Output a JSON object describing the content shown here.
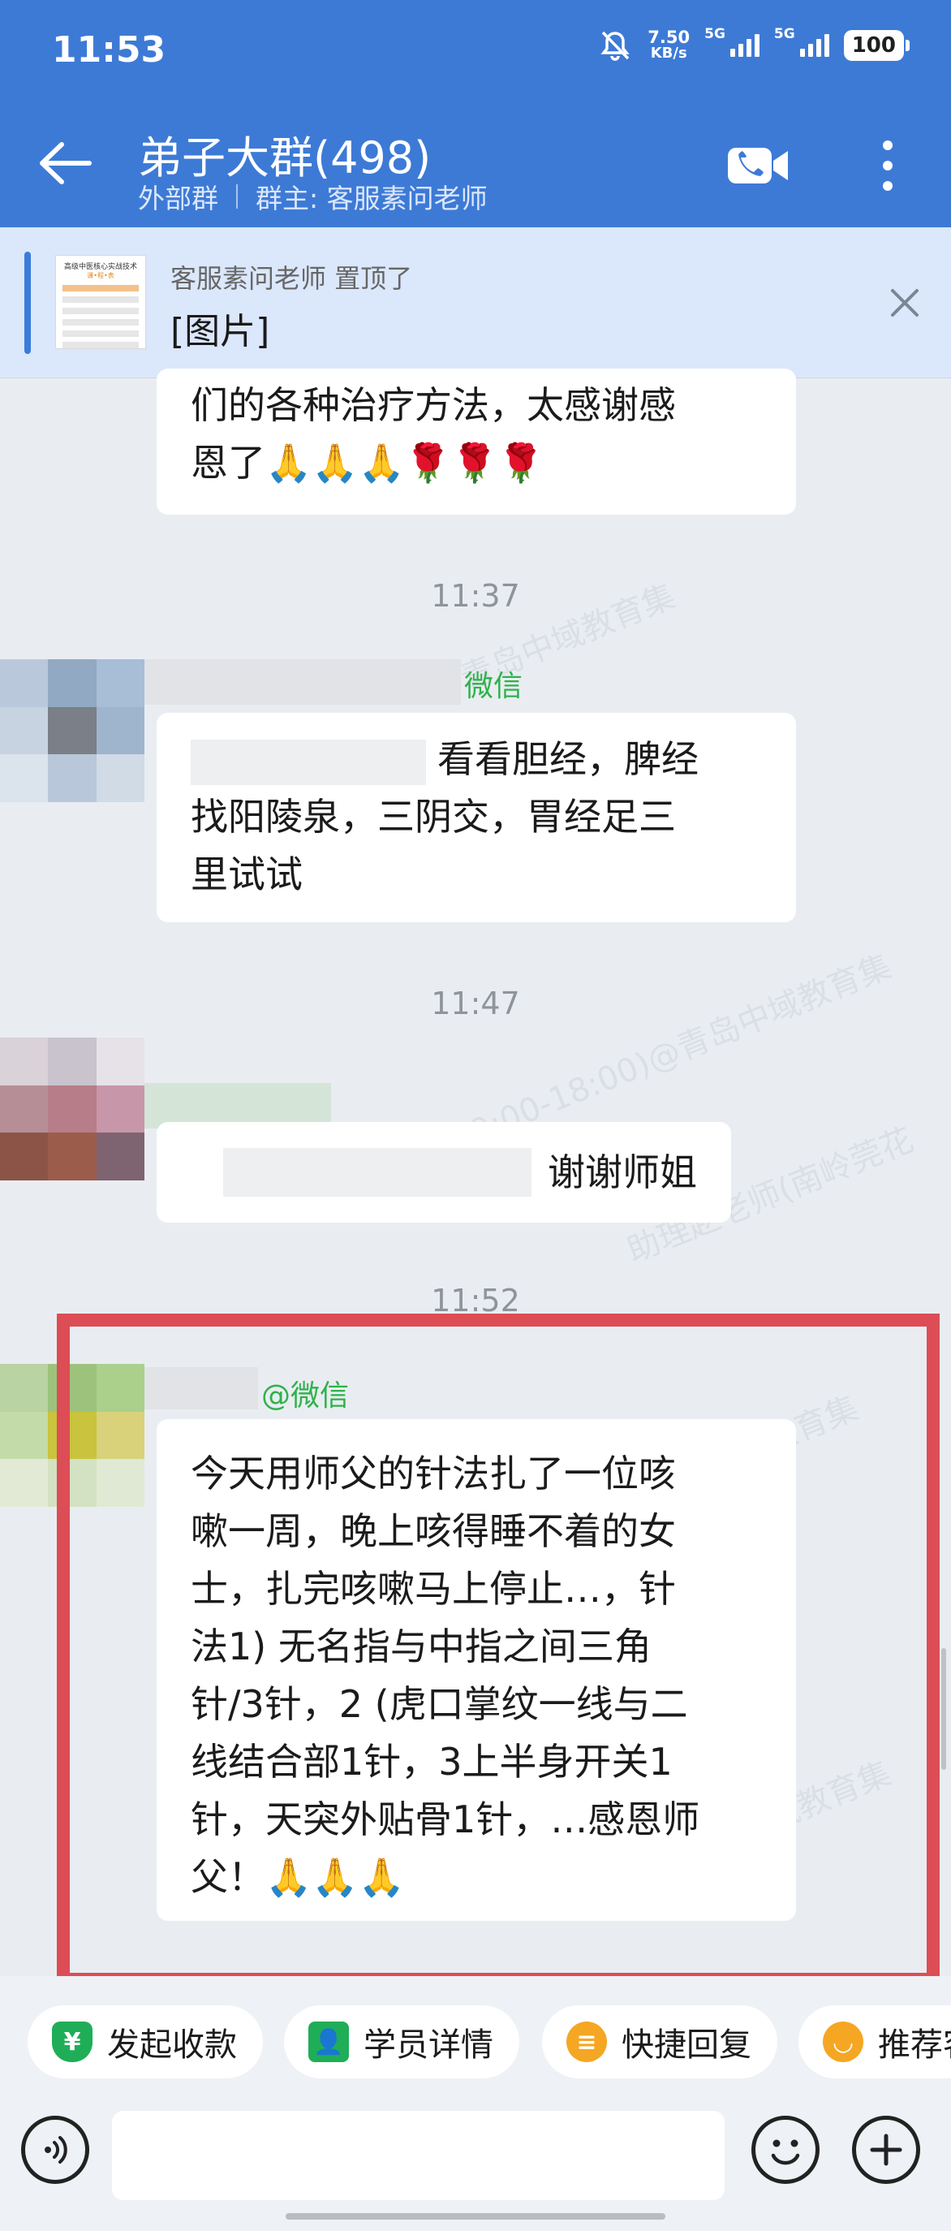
{
  "status_bar": {
    "time": "11:53",
    "net_speed_value": "7.50",
    "net_speed_unit": "KB/s",
    "sim1": "5G",
    "sim2": "5G",
    "battery": "100"
  },
  "header": {
    "title": "弟子大群(498)",
    "group_type": "外部群",
    "owner": "群主: 客服素问老师"
  },
  "pinned": {
    "pinned_by": "客服素问老师 置顶了",
    "content": "[图片]",
    "thumb_title": "高级中医核心实战技术",
    "thumb_sub": "课•程•表"
  },
  "messages": {
    "m1_line1": "们的各种治疗方法，太感谢感",
    "m1_line2": "恩了",
    "m1_emoji": "🙏🙏🙏🌹🌹🌹",
    "ts1": "11:37",
    "m2_sender": "微信",
    "m2_line1": "看看胆经，脾经",
    "m2_line2": "找阳陵泉，三阴交，胃经足三",
    "m2_line3": "里试试",
    "ts2": "11:47",
    "m3_text": "谢谢师姐",
    "ts3": "11:52",
    "m4_sender": "@微信",
    "m4_lines": [
      "今天用师父的针法扎了一位咳",
      "嗽一周，晚上咳得睡不着的女",
      "士，扎完咳嗽马上停止…，针",
      "法1) 无名指与中指之间三角",
      "针/3针，2 (虎口掌纹一线与二",
      "线结合部1针，3上半身开关1",
      "针，天突外贴骨1针，…感恩师"
    ],
    "m4_last": "父！",
    "m4_emoji": "🙏🙏🙏"
  },
  "watermark": {
    "line1": "助理赵老师(南岭莞花（的微）9:00-18:00)@青岛中域教育集"
  },
  "quick_actions": [
    {
      "label": "发起收款",
      "icon": "yuan-shield-icon",
      "color": "#1fae57"
    },
    {
      "label": "学员详情",
      "icon": "person-card-icon",
      "color": "#1fae57"
    },
    {
      "label": "快捷回复",
      "icon": "note-icon",
      "color": "#f5a623"
    },
    {
      "label": "推荐客",
      "icon": "chat-icon",
      "color": "#f5a623"
    }
  ],
  "colors": {
    "header_bg": "#3d7ad6",
    "pinned_bg": "#dbe7fb",
    "chat_bg": "#e9edf2",
    "sender_green": "#2fb24a",
    "highlight_red": "#dd4d55"
  }
}
